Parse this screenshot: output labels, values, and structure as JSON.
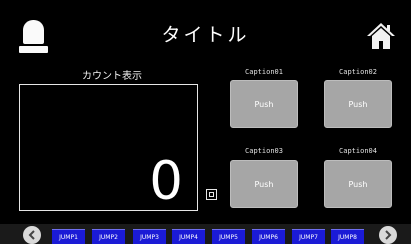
{
  "header": {
    "title": "タイトル",
    "left_icon": "signal-lamp-icon",
    "right_icon": "home-icon"
  },
  "count": {
    "label": "カウント表示",
    "value": "0"
  },
  "buttons": [
    {
      "caption": "Caption01",
      "label": "Push"
    },
    {
      "caption": "Caption02",
      "label": "Push"
    },
    {
      "caption": "Caption03",
      "label": "Push"
    },
    {
      "caption": "Caption04",
      "label": "Push"
    }
  ],
  "footer": {
    "prev_icon": "chevron-left-icon",
    "next_icon": "chevron-right-icon",
    "jumps": [
      "JUMP1",
      "JUMP2",
      "JUMP3",
      "JUMP4",
      "JUMP5",
      "JUMP6",
      "JUMP7",
      "JUMP8"
    ]
  },
  "colors": {
    "background": "#000000",
    "button": "#a6a6a6",
    "jump_button": "#1b1bd6"
  }
}
